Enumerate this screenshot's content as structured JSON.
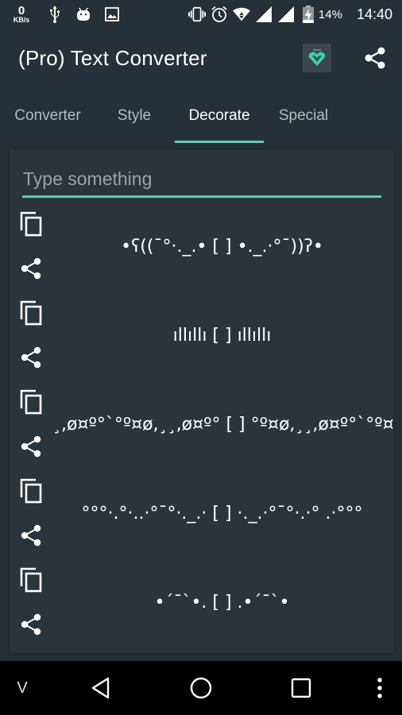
{
  "status_bar": {
    "net_speed_value": "0",
    "net_speed_unit": "KB/s",
    "battery_percent": "14%",
    "time": "14:40",
    "icons": [
      "usb-icon",
      "android-icon",
      "image-icon",
      "vibrate-icon",
      "alarm-icon",
      "wifi-icon",
      "signal-icon",
      "signal-icon",
      "battery-charging-icon"
    ]
  },
  "app_bar": {
    "title": "(Pro) Text Converter",
    "logo_icon": "heart-gem-logo-icon",
    "share_icon": "share-icon"
  },
  "tabs": [
    {
      "label": "Converter",
      "active": false
    },
    {
      "label": "Style",
      "active": false
    },
    {
      "label": "Decorate",
      "active": true
    },
    {
      "label": "Special",
      "active": false
    }
  ],
  "accent_color": "#5ecbb5",
  "input": {
    "value": "",
    "placeholder": "Type something"
  },
  "decorations": [
    {
      "text": "•ʕ((¯°·._.• [ ] •._.·°¯))ʔ•",
      "copy_icon": "copy-icon",
      "share_icon": "share-icon"
    },
    {
      "text": "ıllıllı [ ] ıllıllı",
      "copy_icon": "copy-icon",
      "share_icon": "share-icon"
    },
    {
      "text": "¸,ø¤º°`°º¤ø,¸¸,ø¤º° [ ] °º¤ø,¸¸,ø¤º°`°º¤ø,¸",
      "copy_icon": "copy-icon",
      "share_icon": "share-icon"
    },
    {
      "text": "°°°·.°·..·°¯°·._.· [ ] ·._.·°¯°·.·° .·°°°",
      "copy_icon": "copy-icon",
      "share_icon": "share-icon"
    },
    {
      "text": "•´¯`•. [ ] .•´¯`•",
      "copy_icon": "copy-icon",
      "share_icon": "share-icon"
    }
  ],
  "nav_bar": {
    "keyboard_toggle_label": "V",
    "back_icon": "back-icon",
    "home_icon": "home-icon",
    "recents_icon": "recents-icon",
    "menu_icon": "more-vert-icon"
  }
}
